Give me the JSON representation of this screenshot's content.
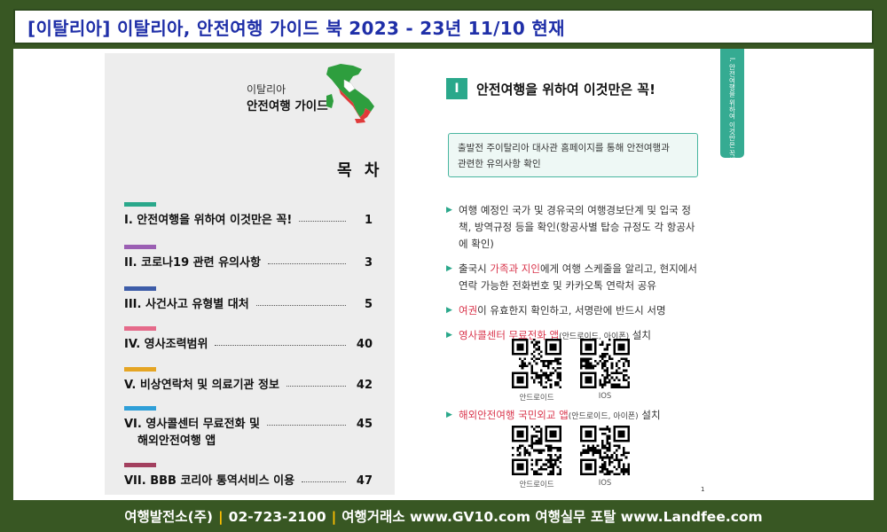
{
  "header": {
    "title": "[이탈리아] 이탈리아,  안전여행 가이드 북  2023 - 23년 11/10 현재"
  },
  "left_page": {
    "country": "이탈리아",
    "guide_name": "안전여행 가이드",
    "toc_heading": "목 차",
    "toc_items": [
      {
        "label": "I. 안전여행을 위하여 이것만은 꼭!",
        "page": "1",
        "color": "#2aa88b"
      },
      {
        "label": "II. 코로나19 관련 유의사항",
        "page": "3",
        "color": "#9b5fb3"
      },
      {
        "label": "III. 사건사고 유형별 대처",
        "page": "5",
        "color": "#3d5ca8"
      },
      {
        "label": "IV. 영사조력범위",
        "page": "40",
        "color": "#e56a8a"
      },
      {
        "label": "V. 비상연락처 및 의료기관 정보",
        "page": "42",
        "color": "#e5a524"
      },
      {
        "label": "VI. 영사콜센터 무료전화 및",
        "label2": "해외안전여행 앱",
        "page": "45",
        "color": "#2f9fd8"
      },
      {
        "label": "VII. BBB 코리아 통역서비스 이용",
        "page": "47",
        "color": "#a3405f"
      }
    ]
  },
  "right_page": {
    "section_number": "I",
    "section_title": "안전여행을 위하여 이것만은 꼭!",
    "notice_line1": "출발전 주이탈리아 대사관 홈페이지를 통해 안전여행과",
    "notice_line2": "관련한 유의사항 확인",
    "bullet1": "여행 예정인 국가 및 경유국의 여행경보단계 및 입국 정책, 방역규정 등을 확인(항공사별 탑승 규정도 각 항공사에 확인)",
    "bullet2_pre": "출국시 ",
    "bullet2_red": "가족과 지인",
    "bullet2_post": "에게 여행 스케줄을 알리고, 현지에서 연락 가능한 전화번호 및 카카오톡 연락처 공유",
    "bullet3_red": "여권",
    "bullet3_post": "이 유효한지 확인하고, 서명란에 반드시 서명",
    "bullet4_red": "영사콜센터 무료전화 앱",
    "bullet4_small": "(안드로이드, 아이폰)",
    "bullet4_post": " 설치",
    "bullet5_red": "해외안전여행 국민외교 앱",
    "bullet5_small": "(안드로이드, 아이폰)",
    "bullet5_post": " 설치",
    "qr_android": "안드로이드",
    "qr_ios": "IOS",
    "page_number": "1",
    "side_tab": "I. 안전여행을 위하여 이것만은 꼭!"
  },
  "footer": {
    "company": "여행발전소(주)",
    "phone": "02-723-2100",
    "part2": "여행거래소   www.GV10.com   여행실무 포탈   www.Landfee.com"
  },
  "colors": {
    "frame_green": "#385723",
    "header_text": "#1f2fa8",
    "accent_teal": "#2aa88b",
    "highlight_red": "#d9344b",
    "footer_separator": "#ffc000"
  }
}
